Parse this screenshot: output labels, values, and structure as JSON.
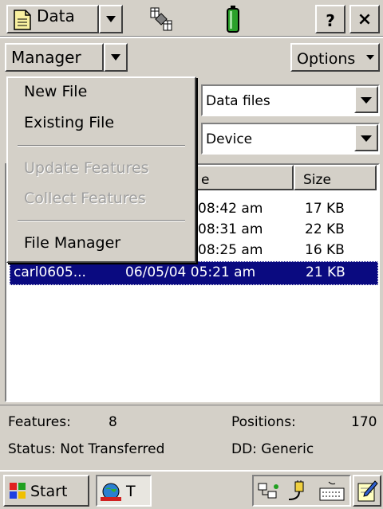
{
  "title_bar": {
    "app_label": "Data",
    "help_label": "?",
    "close_label": "×"
  },
  "toolbar": {
    "manager_label": "Manager",
    "options_label": "Options"
  },
  "menu": {
    "items": [
      {
        "label": "New File",
        "enabled": true
      },
      {
        "label": "Existing File",
        "enabled": true
      },
      {
        "label": "Update Features",
        "enabled": false
      },
      {
        "label": "Collect Features",
        "enabled": false
      },
      {
        "label": "File Manager",
        "enabled": true
      }
    ]
  },
  "form": {
    "file_type_value": "Data files",
    "location_value": "Device"
  },
  "table": {
    "columns": [
      "e",
      "Size"
    ],
    "rows": [
      {
        "name": "",
        "time": "08:42 am",
        "size": "17 KB",
        "selected": false
      },
      {
        "name": "",
        "time": "08:31 am",
        "size": "22 KB",
        "selected": false
      },
      {
        "name": "",
        "time": "08:25 am",
        "size": "16 KB",
        "selected": false
      },
      {
        "name": "carl0605...",
        "time": "06/05/04 05:21 am",
        "size": "21 KB",
        "selected": true
      }
    ]
  },
  "status": {
    "features_label": "Features:",
    "features_value": "8",
    "positions_label": "Positions:",
    "positions_value": "170",
    "status_text": "Status: Not Transferred",
    "dd_text": "DD: Generic"
  },
  "taskbar": {
    "start_label": "Start",
    "task_label": "T"
  },
  "colors": {
    "face": "#d4d0c8",
    "selection": "#0a0a80",
    "battery": "#2aa02a"
  }
}
